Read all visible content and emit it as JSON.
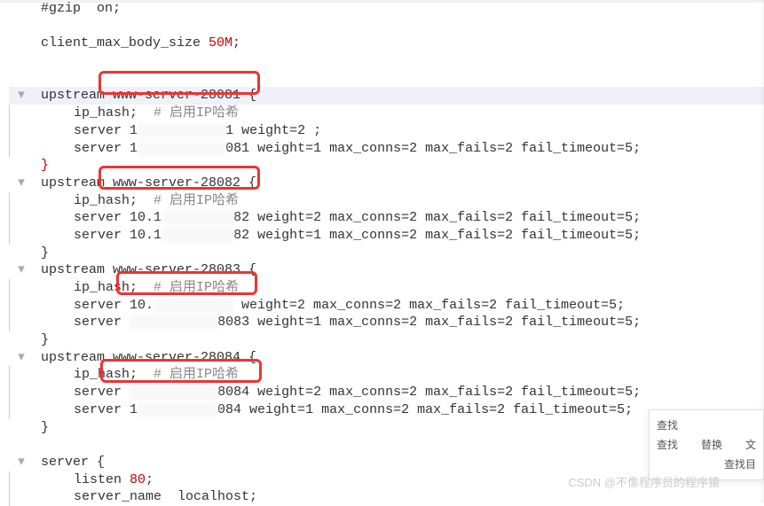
{
  "lines": {
    "l0": {
      "text": "#gzip  on;"
    },
    "l1": {
      "text": ""
    },
    "l2": {
      "pre": "client_max_body_size ",
      "size": "50M",
      ";": ";"
    },
    "l3": {
      "text": ""
    },
    "l4": {
      "text": ""
    },
    "l5": {
      "kw": "upstream",
      "name": " www-server-28081 ",
      "brace": "{"
    },
    "l6": {
      "a": "ip_hash",
      ";": ";",
      "cmt": "  # 启用IP哈希"
    },
    "l7": {
      "a": "server 1",
      "redact": "           ",
      "b": "1 weight=2 ;"
    },
    "l8": {
      "a": "server 1",
      "redact": "           ",
      "b": "081 weight=1 max_conns=2 max_fails=2 fail_timeout=5;"
    },
    "l9": {
      "brace": "}"
    },
    "l10": {
      "kw": "upstream",
      "name": " www-server-28082 ",
      "brace": "{"
    },
    "l11": {
      "a": "ip_hash",
      ";": ";",
      "cmt": "  # 启用IP哈希"
    },
    "l12": {
      "a": "server 10.1",
      "redact": "         ",
      "b": "82 weight=2 max_conns=2 max_fails=2 fail_timeout=5;"
    },
    "l13": {
      "a": "server 10.1",
      "redact": "         ",
      "b": "82 weight=1 max_conns=2 max_fails=2 fail_timeout=5;"
    },
    "l14": {
      "brace": "}"
    },
    "l15": {
      "kw": "upstream",
      "name": " www-server-28083 ",
      "brace": "{"
    },
    "l16": {
      "a": "ip_hash",
      ";": ";",
      "cmt": "  # 启用IP哈希"
    },
    "l17": {
      "a": "server 10.",
      "redact": "          ",
      "b": " weight=2 max_conns=2 max_fails=2 fail_timeout=5;"
    },
    "l18": {
      "a": "server ",
      "redact": "           ",
      "b": "8083 weight=1 max_conns=2 max_fails=2 fail_timeout=5;"
    },
    "l19": {
      "brace": "}"
    },
    "l20": {
      "kw": "upstream",
      "name": " www-server-28084 ",
      "brace": "{"
    },
    "l21": {
      "a": "ip_hash",
      ";": ";",
      "cmt": "  # 启用IP哈希"
    },
    "l22": {
      "a": "server ",
      "redact": "           ",
      "b": "8084 weight=2 max_conns=2 max_fails=2 fail_timeout=5;"
    },
    "l23": {
      "a": "server 1",
      "redact": "          ",
      "b": "084 weight=1 max_conns=2 max_fails=2 fail_timeout=5;"
    },
    "l24": {
      "brace": "}"
    },
    "l25": {
      "text": ""
    },
    "l26": {
      "kw": "server",
      "brace": " {"
    },
    "l27": {
      "a": "listen ",
      "port": "80",
      ";": ";"
    },
    "l28": {
      "a": "server_name  localhost;"
    }
  },
  "boxes": {
    "b1": "www-server-28081",
    "b2": "www-server-28082",
    "b3": "www-server-28083",
    "b4": "www-server-28084"
  },
  "find": {
    "title": "查找",
    "row1a": "查找",
    "row1b": "替换",
    "row1c": "文",
    "row2": "查找目"
  },
  "watermark": "CSDN @不像程序员的程序猿"
}
